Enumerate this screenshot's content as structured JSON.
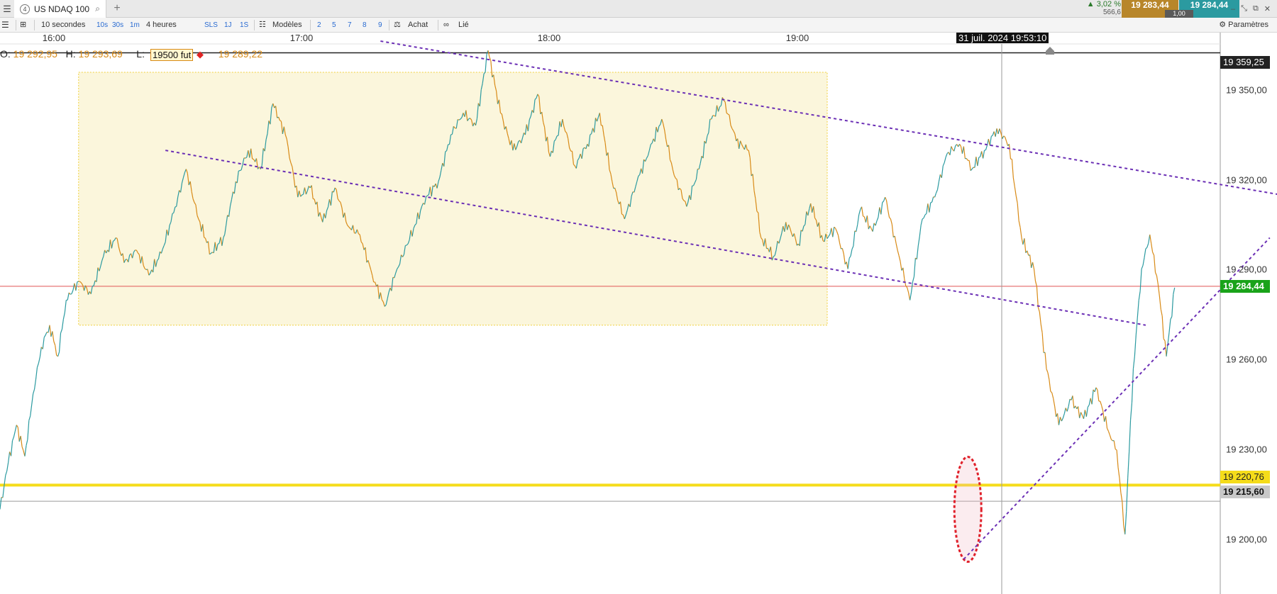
{
  "tab": {
    "number": "4",
    "title": "US NDAQ 100"
  },
  "quote": {
    "change": "▲ 3,02 %",
    "volume": "566,6",
    "bid": "19 283,44",
    "ask": "19 284,44",
    "spread": "1,00"
  },
  "toolbar": {
    "interval": "10 secondes",
    "quick_intervals": [
      "10s",
      "30s",
      "1m"
    ],
    "range": "4 heures",
    "sls": "SLS",
    "periods": [
      "1J",
      "1S"
    ],
    "models": "Modèles",
    "layouts": [
      "2",
      "5",
      "7",
      "8",
      "9"
    ],
    "buy": "Achat",
    "linked": "Lié",
    "settings": "Paramètres"
  },
  "ohlc": {
    "o_label": "O:",
    "o": "19 292,95",
    "h_label": "H:",
    "h": "19 293,69",
    "l_label": "L:",
    "c": "19 289,22"
  },
  "marker_label": "19500 fut",
  "crosshair_time": "31 juil. 2024 19:53:10",
  "chart_data": {
    "type": "line",
    "x_ticks": [
      "16:00",
      "17:00",
      "18:00",
      "19:00"
    ],
    "y_ticks": [
      "19 350,00",
      "19 320,00",
      "19 290,00",
      "19 260,00",
      "19 230,00",
      "19 200,00"
    ],
    "ylim": [
      19187,
      19363
    ],
    "price_tags": {
      "top": "19 359,25",
      "current": "19 284,44",
      "support": "19 220,76",
      "crosshair": "19 215,60"
    },
    "colors": {
      "up": "#2b9aa0",
      "down": "#d88a16",
      "current": "#1aa31a",
      "support": "#f5dc1a",
      "trend": "#6b2fb5"
    },
    "series": [
      {
        "x": [
          0,
          2,
          4,
          6,
          8,
          10,
          12,
          14,
          16,
          19,
          22,
          25,
          28,
          30,
          33,
          36,
          39,
          42,
          45,
          48,
          51,
          54,
          57,
          60,
          63,
          66,
          69,
          72,
          75,
          78,
          81,
          84,
          87,
          90,
          93,
          96,
          100,
          103,
          106,
          109,
          112,
          115,
          118,
          121,
          124,
          127,
          130,
          133,
          136,
          139,
          142,
          145,
          148,
          151,
          154,
          157,
          160,
          163,
          166,
          169,
          172,
          175,
          178,
          181,
          184,
          187,
          190,
          193,
          196,
          199,
          202,
          205,
          208,
          211,
          214,
          217,
          220,
          223,
          226,
          229,
          232,
          235,
          238,
          241,
          244,
          247,
          250,
          253,
          256,
          259,
          262,
          265,
          268,
          270,
          272,
          274,
          276,
          278,
          280,
          282,
          284
        ],
        "y": [
          19213,
          19228,
          19240,
          19230,
          19250,
          19265,
          19272,
          19262,
          19280,
          19286,
          19282,
          19294,
          19300,
          19292,
          19296,
          19288,
          19295,
          19308,
          19322,
          19306,
          19295,
          19300,
          19318,
          19328,
          19322,
          19343,
          19333,
          19313,
          19316,
          19305,
          19316,
          19304,
          19301,
          19288,
          19278,
          19290,
          19303,
          19313,
          19318,
          19333,
          19340,
          19336,
          19360,
          19340,
          19328,
          19333,
          19346,
          19326,
          19338,
          19323,
          19330,
          19340,
          19318,
          19306,
          19318,
          19328,
          19338,
          19320,
          19310,
          19322,
          19338,
          19344,
          19331,
          19328,
          19300,
          19294,
          19305,
          19298,
          19311,
          19299,
          19303,
          19290,
          19309,
          19302,
          19313,
          19296,
          19280,
          19306,
          19313,
          19327,
          19330,
          19322,
          19328,
          19335,
          19330,
          19300,
          19290,
          19258,
          19240,
          19248,
          19242,
          19252,
          19238,
          19232,
          19205,
          19258,
          19290,
          19301,
          19285,
          19262,
          19284
        ]
      }
    ],
    "trendlines": [
      {
        "from": [
          40,
          19328
        ],
        "to": [
          277,
          19272
        ]
      },
      {
        "from": [
          92,
          19363
        ],
        "to": [
          313,
          19313
        ]
      },
      {
        "from": [
          233,
          19197
        ],
        "to": [
          307,
          19300
        ]
      }
    ],
    "zone": {
      "x": [
        19,
        200
      ],
      "y": [
        19272,
        19353
      ]
    },
    "highlight_circle": {
      "x": 234,
      "y": 19213
    }
  }
}
